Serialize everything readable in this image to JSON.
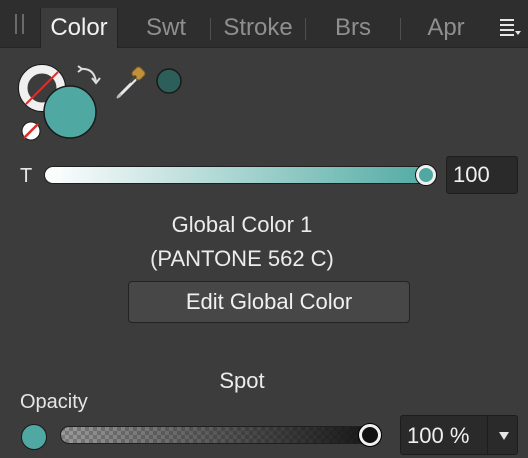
{
  "tabs": [
    {
      "label": "Color",
      "active": true
    },
    {
      "label": "Swt",
      "active": false
    },
    {
      "label": "Stroke",
      "active": false
    },
    {
      "label": "Brs",
      "active": false
    },
    {
      "label": "Apr",
      "active": false
    }
  ],
  "colors": {
    "fill": "#4fa9a2",
    "picked": "#2c5e5a",
    "panel_bg": "#3c3c3c",
    "tabbar_bg": "#2e2e2e"
  },
  "icons": {
    "grip": "grip-icon",
    "menu": "panel-menu-icon",
    "swap": "swap-arrows-icon",
    "none": "no-fill-icon",
    "picker": "eyedropper-icon"
  },
  "tint": {
    "label": "T",
    "value": "100",
    "percent": 1.0
  },
  "global_color": {
    "name": "Global Color 1",
    "pantone": "(PANTONE 562 C)",
    "edit_label": "Edit Global Color",
    "type": "Spot"
  },
  "opacity": {
    "label": "Opacity",
    "value": "100 %",
    "percent": 1.0
  }
}
